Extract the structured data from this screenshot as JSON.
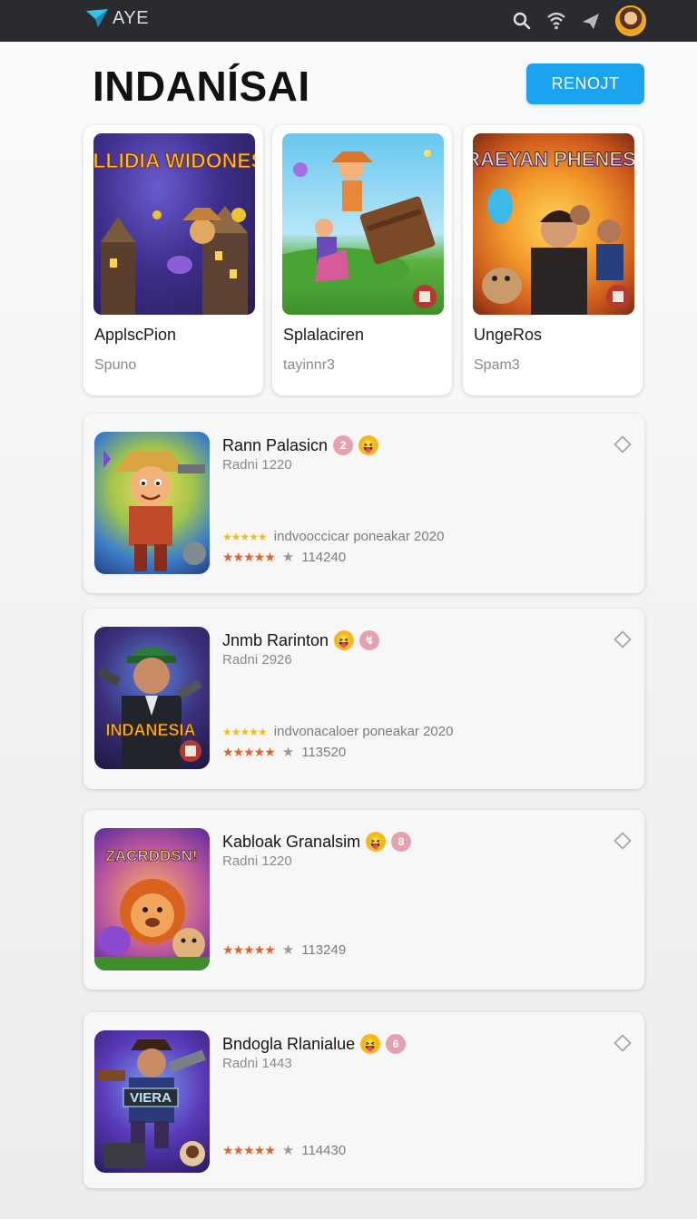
{
  "topbar": {
    "brand": "AYE",
    "icons": [
      "search-icon",
      "wifi-icon",
      "send-icon",
      "avatar"
    ]
  },
  "header": {
    "title": "INDANÍSAI",
    "report_label": "RENOJT"
  },
  "cards": [
    {
      "art_title": "CALLIDIA WIDONESIA",
      "title": "ApplscPion",
      "sub": "Spuno"
    },
    {
      "art_title": "",
      "title": "Splalaciren",
      "sub": "tayinnr3"
    },
    {
      "art_title": "CRAEYAN PHENESIA",
      "title": "UngeRos",
      "sub": "Spam3"
    }
  ],
  "rows": [
    {
      "title": "Rann Palasicn",
      "badge_a": "2",
      "badge_b": "😝",
      "meta": "Radni 1220",
      "desc": "indvooccicar poneakar 2020",
      "count": "114240",
      "art_title": ""
    },
    {
      "title": "Jnmb Rarinton",
      "badge_a": "😝",
      "badge_b": "↯",
      "meta": "Radni 2926",
      "desc": "indvonacaloer poneakar 2020",
      "count": "113520",
      "art_title": "INDANESIA"
    },
    {
      "title": "Kabloak Granalsim",
      "badge_a": "😝",
      "badge_b": "8",
      "meta": "Radni 1220",
      "desc": "",
      "count": "113249",
      "art_title": "ZACRDDSN!"
    },
    {
      "title": "Bndogla Rlanialue",
      "badge_a": "😝",
      "badge_b": "6",
      "meta": "Radni 1443",
      "desc": "",
      "count": "114430",
      "art_title": "VIERA"
    }
  ],
  "colors": {
    "accent": "#1aa3ee",
    "topbar": "#2a2b2e",
    "star_yellow": "#f1bd15",
    "star_red": "#e2622c"
  }
}
